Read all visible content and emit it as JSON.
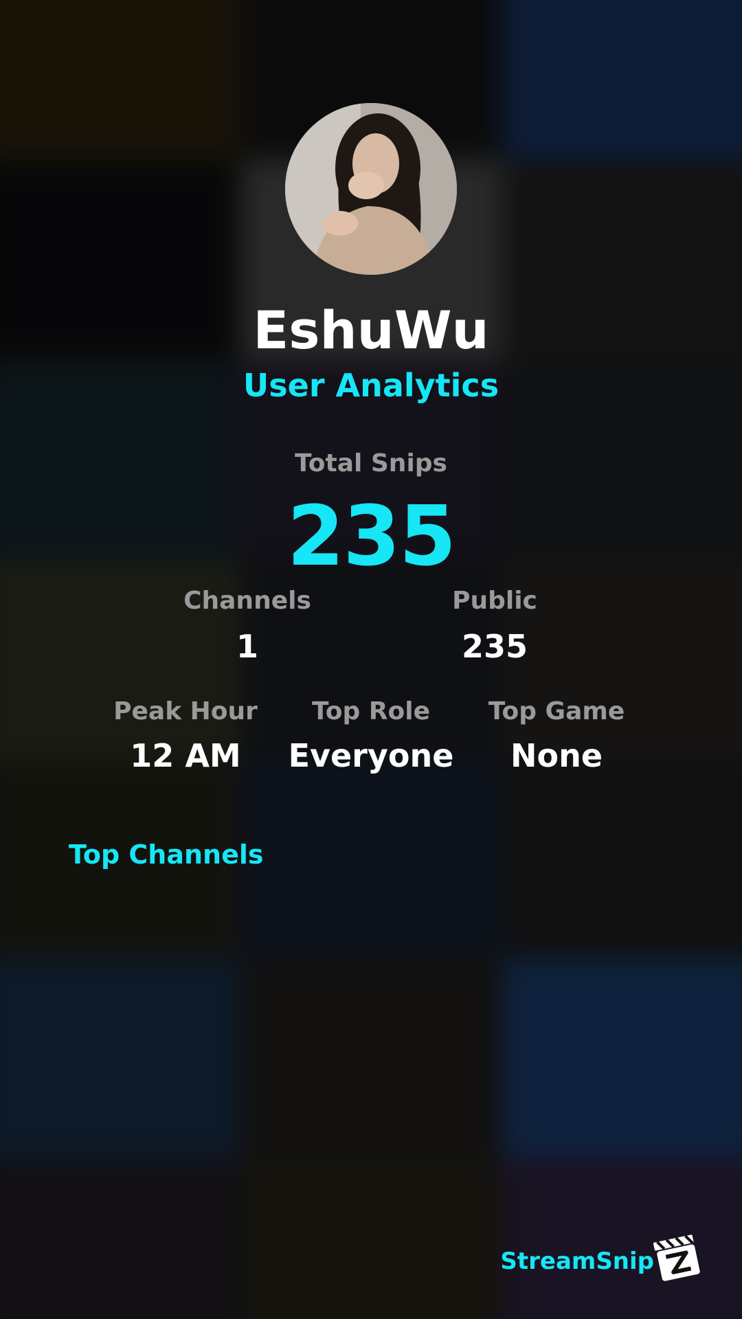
{
  "profile": {
    "username": "EshuWu",
    "subtitle": "User Analytics"
  },
  "stats": {
    "total_snips_label": "Total Snips",
    "total_snips_value": "235",
    "channels_label": "Channels",
    "channels_value": "1",
    "public_label": "Public",
    "public_value": "235",
    "peak_hour_label": "Peak Hour",
    "peak_hour_value": "12 AM",
    "top_role_label": "Top Role",
    "top_role_value": "Everyone",
    "top_game_label": "Top Game",
    "top_game_value": "None"
  },
  "sections": {
    "top_channels": "Top Channels"
  },
  "brand": {
    "name": "StreamSnip",
    "logo_icon": "clapperboard-icon"
  },
  "colors": {
    "accent": "#16e6f5",
    "label": "#9a9a9a",
    "value": "#ffffff",
    "background": "#0b0b0d"
  }
}
